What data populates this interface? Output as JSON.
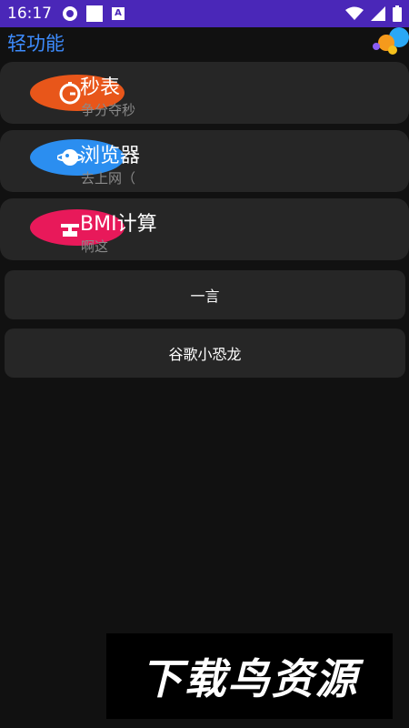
{
  "status_bar": {
    "time": "16:17",
    "icons": [
      "circle-notification-icon",
      "square-notification-icon",
      "a-notification-icon",
      "wifi-icon",
      "signal-icon",
      "battery-icon"
    ]
  },
  "app_bar": {
    "title": "轻功能",
    "logo": "bubbles-logo"
  },
  "features": [
    {
      "title": "秒表",
      "subtitle": "争分夺秒",
      "color": "#e8561a",
      "icon": "stopwatch-icon"
    },
    {
      "title": "浏览器",
      "subtitle": "去上网（",
      "color": "#2b8ef0",
      "icon": "planet-icon"
    },
    {
      "title": "BMI计算",
      "subtitle": "啊这",
      "color": "#e8195a",
      "icon": "scale-icon"
    }
  ],
  "buttons": [
    {
      "label": "一言"
    },
    {
      "label": "谷歌小恐龙"
    }
  ],
  "watermark": {
    "text": "下载鸟资源"
  },
  "colors": {
    "status_bar": "#4a27b8",
    "background": "#111111",
    "card": "#262626",
    "title_accent": "#3d8bfd"
  }
}
